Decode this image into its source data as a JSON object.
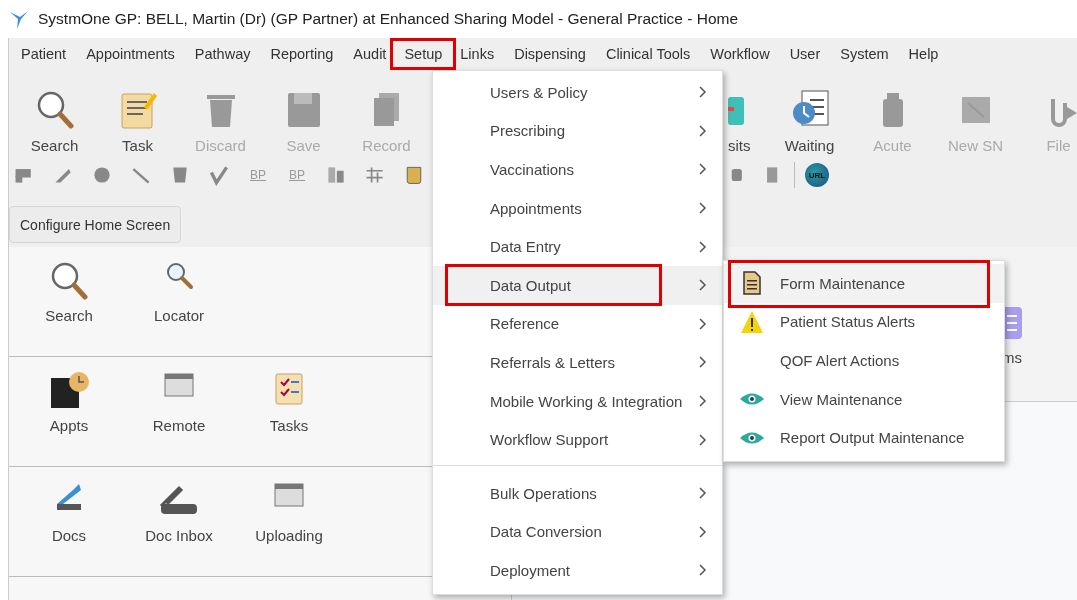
{
  "window": {
    "title": "SystmOne GP: BELL, Martin (Dr) (GP Partner) at Enhanced Sharing Model - General Practice - Home"
  },
  "menu_bar": [
    {
      "label": "Patient",
      "highlighted": false
    },
    {
      "label": "Appointments",
      "highlighted": false
    },
    {
      "label": "Pathway",
      "highlighted": false
    },
    {
      "label": "Reporting",
      "highlighted": false
    },
    {
      "label": "Audit",
      "highlighted": false
    },
    {
      "label": "Setup",
      "highlighted": true
    },
    {
      "label": "Links",
      "highlighted": false
    },
    {
      "label": "Dispensing",
      "highlighted": false
    },
    {
      "label": "Clinical Tools",
      "highlighted": false
    },
    {
      "label": "Workflow",
      "highlighted": false
    },
    {
      "label": "User",
      "highlighted": false
    },
    {
      "label": "System",
      "highlighted": false
    },
    {
      "label": "Help",
      "highlighted": false
    }
  ],
  "toolbar_left": [
    {
      "label": "Search",
      "disabled": false
    },
    {
      "label": "Task",
      "disabled": false
    },
    {
      "label": "Discard",
      "disabled": true
    },
    {
      "label": "Save",
      "disabled": true
    },
    {
      "label": "Record",
      "disabled": true
    }
  ],
  "toolbar_right": [
    {
      "label": "sits",
      "disabled": false
    },
    {
      "label": "Waiting",
      "disabled": false
    },
    {
      "label": "Acute",
      "disabled": true
    },
    {
      "label": "New SN",
      "disabled": true
    },
    {
      "label": "File",
      "disabled": true
    }
  ],
  "small_tools_left": [
    {
      "kind": "icon"
    },
    {
      "kind": "icon"
    },
    {
      "kind": "icon"
    },
    {
      "kind": "icon"
    },
    {
      "kind": "icon"
    },
    {
      "kind": "icon"
    },
    {
      "kind": "text",
      "text": "BP"
    },
    {
      "kind": "text",
      "text": "BP"
    },
    {
      "kind": "icon"
    },
    {
      "kind": "icon"
    },
    {
      "kind": "icon"
    }
  ],
  "small_tools_right": [
    {
      "kind": "icon"
    },
    {
      "kind": "icon"
    },
    {
      "kind": "text",
      "text": "URL"
    }
  ],
  "configure_button": "Configure Home Screen",
  "home_sections": [
    {
      "items": [
        "Search",
        "Locator"
      ]
    },
    {
      "items": [
        "Appts",
        "Remote",
        "Tasks"
      ]
    },
    {
      "items": [
        "Docs",
        "Doc Inbox",
        "Uploading"
      ]
    }
  ],
  "side_label": "ms",
  "setup_menu": [
    [
      {
        "label": "Users & Policy",
        "selected": false,
        "highlighted": false
      },
      {
        "label": "Prescribing",
        "selected": false,
        "highlighted": false
      },
      {
        "label": "Vaccinations",
        "selected": false,
        "highlighted": false
      },
      {
        "label": "Appointments",
        "selected": false,
        "highlighted": false
      },
      {
        "label": "Data Entry",
        "selected": false,
        "highlighted": false
      },
      {
        "label": "Data Output",
        "selected": true,
        "highlighted": true
      },
      {
        "label": "Reference",
        "selected": false,
        "highlighted": false
      },
      {
        "label": "Referrals & Letters",
        "selected": false,
        "highlighted": false
      },
      {
        "label": "Mobile Working & Integration",
        "selected": false,
        "highlighted": false
      },
      {
        "label": "Workflow Support",
        "selected": false,
        "highlighted": false
      }
    ],
    [
      {
        "label": "Bulk Operations",
        "selected": false,
        "highlighted": false
      },
      {
        "label": "Data Conversion",
        "selected": false,
        "highlighted": false
      },
      {
        "label": "Deployment",
        "selected": false,
        "highlighted": false
      }
    ]
  ],
  "data_output_submenu": [
    {
      "label": "Form Maintenance",
      "selected": true,
      "highlighted": true
    },
    {
      "label": "Patient Status Alerts",
      "selected": false,
      "highlighted": false
    },
    {
      "label": "QOF Alert Actions",
      "selected": false,
      "highlighted": false
    },
    {
      "label": "View Maintenance",
      "selected": false,
      "highlighted": false
    },
    {
      "label": "Report Output Maintenance",
      "selected": false,
      "highlighted": false
    }
  ]
}
